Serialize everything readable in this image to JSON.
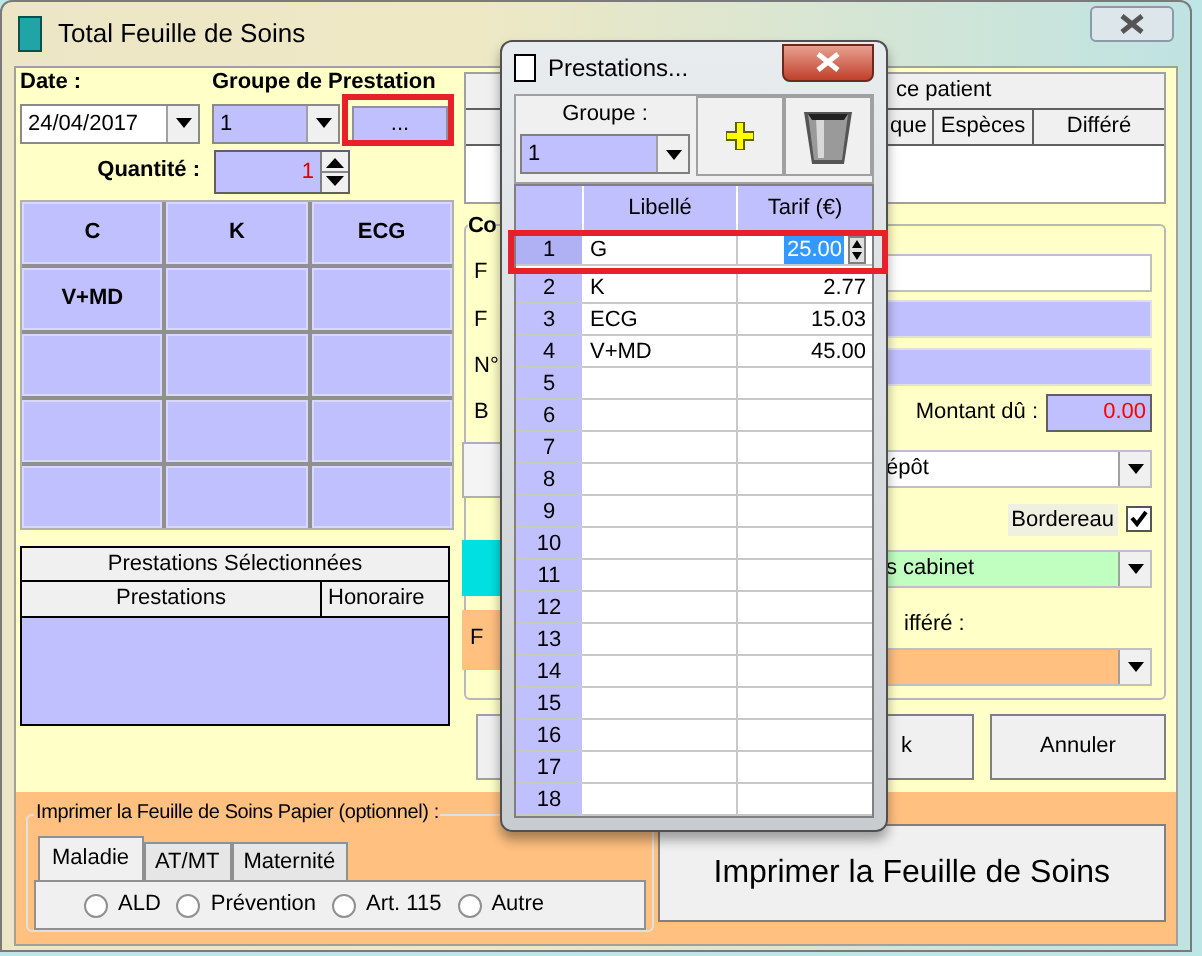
{
  "main_window": {
    "title": "Total Feuille de Soins",
    "date_label": "Date :",
    "date_value": "24/04/2017",
    "group_label": "Groupe de Prestation",
    "group_value": "1",
    "group_button": "...",
    "quantity_label": "Quantité :",
    "quantity_value": "1",
    "acts": [
      "C",
      "K",
      "ECG",
      "V+MD"
    ],
    "selected_list": {
      "title": "Prestations Sélectionnées",
      "columns": [
        "Prestations",
        "Honoraire"
      ]
    },
    "right_panel": {
      "patient_header": "ce patient",
      "payment_columns": [
        "que",
        "Espèces",
        "Différé"
      ],
      "group_title": "Co",
      "field_labels": [
        "F",
        "F",
        "N°",
        "B"
      ],
      "amount_label": "Montant dû :",
      "amount_value": "0.00",
      "deposit_value": "épôt",
      "bordereau_label": "Bordereau",
      "bordereau_checked": true,
      "location_value": "s cabinet",
      "deferred_label": "ifféré :",
      "side_label": "F",
      "ok_button": "k",
      "cancel_button": "Annuler"
    },
    "print_group": {
      "title": "Imprimer la Feuille de Soins Papier (optionnel) :",
      "tabs": [
        {
          "label": "Maladie",
          "selected": true
        },
        {
          "label": "AT/MT",
          "selected": false
        },
        {
          "label": "Maternité",
          "selected": false
        }
      ],
      "radios": [
        {
          "label": "ALD",
          "checked": false
        },
        {
          "label": "Prévention",
          "checked": false
        },
        {
          "label": "Art. 115",
          "checked": false
        },
        {
          "label": "Autre",
          "checked": false
        }
      ],
      "print_button": "Imprimer la Feuille de Soins"
    }
  },
  "dialog": {
    "title": "Prestations...",
    "group_label": "Groupe :",
    "group_value": "1",
    "columns": [
      "Libellé",
      "Tarif (€)"
    ],
    "rows": [
      {
        "number": "1",
        "label": "G",
        "price": "25.00",
        "selected": true
      },
      {
        "number": "2",
        "label": "K",
        "price": "2.77",
        "selected": false
      },
      {
        "number": "3",
        "label": "ECG",
        "price": "15.03",
        "selected": false
      },
      {
        "number": "4",
        "label": "V+MD",
        "price": "45.00",
        "selected": false
      },
      {
        "number": "5",
        "selected": false
      },
      {
        "number": "6",
        "selected": false
      },
      {
        "number": "7",
        "selected": false
      },
      {
        "number": "8",
        "selected": false
      },
      {
        "number": "9",
        "selected": false
      },
      {
        "number": "10",
        "selected": false
      },
      {
        "number": "11",
        "selected": false
      },
      {
        "number": "12",
        "selected": false
      },
      {
        "number": "13",
        "selected": false
      },
      {
        "number": "14",
        "selected": false
      },
      {
        "number": "15",
        "selected": false
      },
      {
        "number": "16",
        "selected": false
      },
      {
        "number": "17",
        "selected": false
      },
      {
        "number": "18",
        "selected": false
      }
    ]
  }
}
